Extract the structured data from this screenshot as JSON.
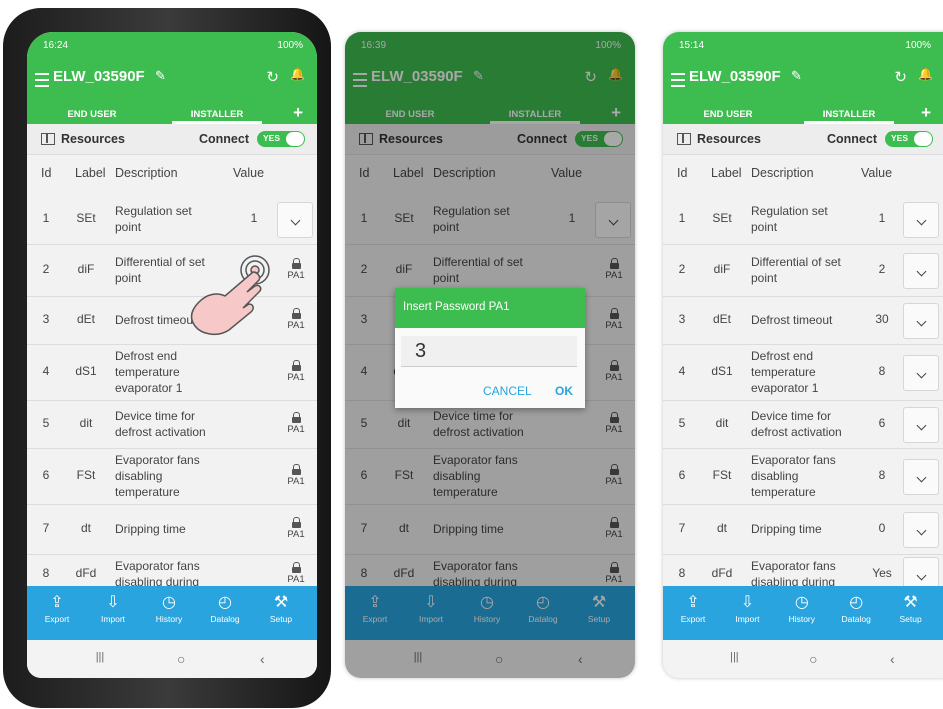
{
  "app": {
    "title": "ELW_03590F",
    "tabs": [
      "END USER",
      "INSTALLER"
    ],
    "tab_add": "+",
    "resources_label": "Resources",
    "connect_label": "Connect",
    "toggle_label": "YES",
    "columns": [
      "Id",
      "Label",
      "Description",
      "Value"
    ],
    "bottom_nav": [
      "Export",
      "Import",
      "History",
      "Datalog",
      "Setup"
    ],
    "lock_label": "PA1",
    "icons": {
      "menu": "hamburger-icon",
      "edit": "pencil-icon",
      "refresh": "refresh-icon",
      "bell": "bell-icon",
      "export": "export-icon",
      "import": "import-icon",
      "history": "clock-icon",
      "datalog": "timer-icon",
      "setup": "tools-icon",
      "lock": "lock-icon",
      "touch": "tap-hand-icon"
    },
    "colors": {
      "primary": "#3dbd4f",
      "bottom_bar": "#29a4de"
    }
  },
  "screens": [
    {
      "status": {
        "time": "16:24",
        "right": "100%"
      },
      "rows": [
        {
          "id": "1",
          "label": "SEt",
          "desc": [
            "Regulation set",
            "point"
          ],
          "value": "1",
          "control": "dropdown"
        },
        {
          "id": "2",
          "label": "diF",
          "desc": [
            "Differential of set",
            "point"
          ],
          "value": "",
          "control": "lock"
        },
        {
          "id": "3",
          "label": "dEt",
          "desc": [
            "Defrost timeout"
          ],
          "value": "",
          "control": "lock"
        },
        {
          "id": "4",
          "label": "dS1",
          "desc": [
            "Defrost end",
            "temperature",
            "evaporator 1"
          ],
          "value": "",
          "control": "lock"
        },
        {
          "id": "5",
          "label": "dit",
          "desc": [
            "Device time for",
            "defrost activation"
          ],
          "value": "",
          "control": "lock"
        },
        {
          "id": "6",
          "label": "FSt",
          "desc": [
            "Evaporator fans",
            "disabling",
            "temperature"
          ],
          "value": "",
          "control": "lock"
        },
        {
          "id": "7",
          "label": "dt",
          "desc": [
            "Dripping time"
          ],
          "value": "",
          "control": "lock"
        },
        {
          "id": "8",
          "label": "dFd",
          "desc": [
            "Evaporator fans",
            "disabling during"
          ],
          "value": "",
          "control": "lock"
        }
      ]
    },
    {
      "status": {
        "time": "16:39",
        "right": "100%"
      },
      "dialog": {
        "title": "Insert Password PA1",
        "value": "3",
        "cancel": "CANCEL",
        "ok": "OK"
      },
      "rows": [
        {
          "id": "1",
          "label": "SEt",
          "desc": [
            "Regulation set",
            "point"
          ],
          "value": "1",
          "control": "dropdown"
        },
        {
          "id": "2",
          "label": "diF",
          "desc": [
            "Differential of set",
            "point"
          ],
          "value": "",
          "control": "lock"
        },
        {
          "id": "3",
          "label": "dEt",
          "desc": [
            ""
          ],
          "value": "",
          "control": "lock"
        },
        {
          "id": "4",
          "label": "dS1",
          "desc": [
            ""
          ],
          "value": "",
          "control": "lock"
        },
        {
          "id": "5",
          "label": "dit",
          "desc": [
            "Device time for",
            "defrost activation"
          ],
          "value": "",
          "control": "lock"
        },
        {
          "id": "6",
          "label": "FSt",
          "desc": [
            "Evaporator fans",
            "disabling",
            "temperature"
          ],
          "value": "",
          "control": "lock"
        },
        {
          "id": "7",
          "label": "dt",
          "desc": [
            "Dripping time"
          ],
          "value": "",
          "control": "lock"
        },
        {
          "id": "8",
          "label": "dFd",
          "desc": [
            "Evaporator fans",
            "disabling during"
          ],
          "value": "",
          "control": "lock"
        }
      ]
    },
    {
      "status": {
        "time": "15:14",
        "right": "100%"
      },
      "rows": [
        {
          "id": "1",
          "label": "SEt",
          "desc": [
            "Regulation set",
            "point"
          ],
          "value": "1",
          "control": "dropdown"
        },
        {
          "id": "2",
          "label": "diF",
          "desc": [
            "Differential of set",
            "point"
          ],
          "value": "2",
          "control": "dropdown"
        },
        {
          "id": "3",
          "label": "dEt",
          "desc": [
            "Defrost timeout"
          ],
          "value": "30",
          "control": "dropdown"
        },
        {
          "id": "4",
          "label": "dS1",
          "desc": [
            "Defrost end",
            "temperature",
            "evaporator 1"
          ],
          "value": "8",
          "control": "dropdown"
        },
        {
          "id": "5",
          "label": "dit",
          "desc": [
            "Device time for",
            "defrost activation"
          ],
          "value": "6",
          "control": "dropdown"
        },
        {
          "id": "6",
          "label": "FSt",
          "desc": [
            "Evaporator fans",
            "disabling",
            "temperature"
          ],
          "value": "8",
          "control": "dropdown"
        },
        {
          "id": "7",
          "label": "dt",
          "desc": [
            "Dripping time"
          ],
          "value": "0",
          "control": "dropdown"
        },
        {
          "id": "8",
          "label": "dFd",
          "desc": [
            "Evaporator fans",
            "disabling during"
          ],
          "value": "Yes",
          "control": "dropdown"
        }
      ]
    }
  ]
}
